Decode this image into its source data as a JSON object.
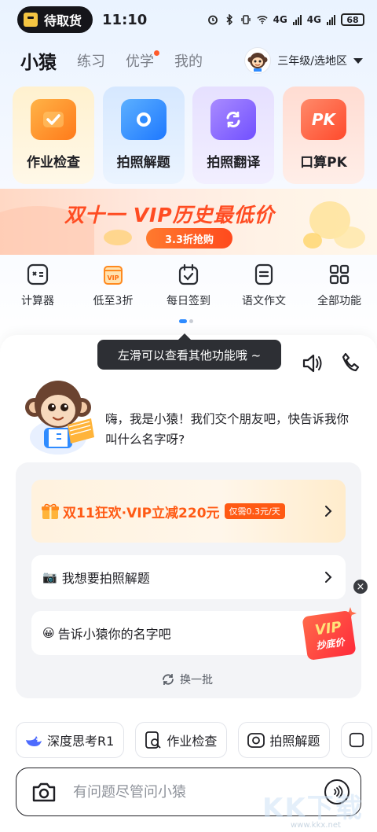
{
  "status_bar": {
    "pickup_label": "待取货",
    "time": "11:10",
    "network_1": "4G",
    "network_2": "4G",
    "battery": "68",
    "icons": [
      "alarm-icon",
      "bluetooth-icon",
      "vibrate-icon",
      "wifi-icon"
    ]
  },
  "header": {
    "tabs": [
      {
        "label": "小猿",
        "active": true
      },
      {
        "label": "练习",
        "active": false
      },
      {
        "label": "优学",
        "active": false,
        "badge": true
      },
      {
        "label": "我的",
        "active": false
      }
    ],
    "grade_label": "三年级/选地区"
  },
  "tools": [
    {
      "label": "作业检查",
      "icon": "checkmark-icon",
      "bg": "#fff3d6",
      "icon_color": "#ff8a1f"
    },
    {
      "label": "拍照解题",
      "icon": "camera-lens-icon",
      "bg": "#dcebff",
      "icon_color": "#2e8bff"
    },
    {
      "label": "拍照翻译",
      "icon": "translate-refresh-icon",
      "bg": "#ebe6ff",
      "icon_color": "#8a63ff"
    },
    {
      "label": "口算PK",
      "icon": "pk-icon",
      "bg": "#ffe4dc",
      "icon_color": "#ff5a3c"
    }
  ],
  "banner": {
    "title": "双十一 VIP历史最低价",
    "button": "3.3折抢购"
  },
  "funcs": [
    {
      "label": "计算器",
      "icon": "calculator-icon"
    },
    {
      "label": "低至3折",
      "icon": "vip-card-icon"
    },
    {
      "label": "每日签到",
      "icon": "calendar-check-icon"
    },
    {
      "label": "语文作文",
      "icon": "composition-icon"
    },
    {
      "label": "全部功能",
      "icon": "grid-icon"
    }
  ],
  "tooltip": "左滑可以查看其他功能哦 ~",
  "chat": {
    "greeting": "嗨，我是小猿！我们交个朋友吧，快告诉我你叫什么名字呀?",
    "vip_row": {
      "text": "双11狂欢·VIP立减220元",
      "tag": "仅需0.3元/天"
    },
    "suggestions": [
      {
        "emoji": "📷",
        "text": "我想要拍照解题"
      },
      {
        "emoji": "😀",
        "text": "告诉小猿你的名字吧"
      }
    ],
    "sticker": {
      "line1": "VIP",
      "line2": "抄底价"
    },
    "refresh_label": "换一批"
  },
  "chips": [
    {
      "label": "深度思考R1",
      "icon": "deepseek-whale-icon"
    },
    {
      "label": "作业检查",
      "icon": "doc-search-icon"
    },
    {
      "label": "拍照解题",
      "icon": "camera-icon"
    }
  ],
  "input": {
    "placeholder": "有问题尽管问小猿"
  },
  "watermark": {
    "text": "KK下载",
    "url": "www.kkx.net"
  }
}
